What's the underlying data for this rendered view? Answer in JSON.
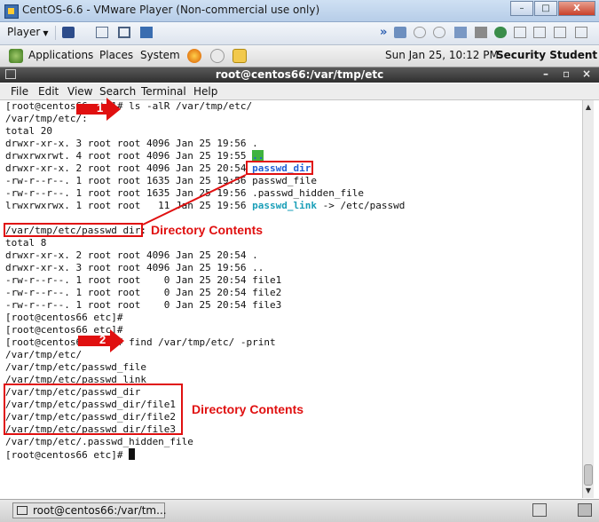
{
  "window": {
    "title": "CentOS-6.6 - VMware Player (Non-commercial use only)",
    "minimize": "–",
    "maximize": "□",
    "close": "X"
  },
  "vm_toolbar": {
    "player_label": "Player",
    "forward_glyph": "»"
  },
  "gnome_panel": {
    "applications": "Applications",
    "places": "Places",
    "system": "System",
    "datetime": "Sun Jan 25, 10:12 PM",
    "user": "Security Student"
  },
  "terminal": {
    "title": "root@centos66:/var/tmp/etc",
    "controls": [
      "–",
      "▫",
      "×"
    ],
    "menu": [
      "File",
      "Edit",
      "View",
      "Search",
      "Terminal",
      "Help"
    ],
    "lines": [
      "[root@centos66 etc]# ls -alR /var/tmp/etc/",
      "/var/tmp/etc/:",
      "total 20",
      "drwxr-xr-x. 3 root root 4096 Jan 25 19:56 .",
      "drwxrwxrwt. 4 root root 4096 Jan 25 19:55 ..",
      "drwxr-xr-x. 2 root root 4096 Jan 25 20:54 passwd_dir",
      "-rw-r--r--. 1 root root 1635 Jan 25 19:56 passwd_file",
      "-rw-r--r--. 1 root root 1635 Jan 25 19:56 .passwd_hidden_file",
      "lrwxrwxrwx. 1 root root   11 Jan 25 19:56 passwd_link -> /etc/passwd",
      "",
      "/var/tmp/etc/passwd_dir:",
      "total 8",
      "drwxr-xr-x. 2 root root 4096 Jan 25 20:54 .",
      "drwxr-xr-x. 3 root root 4096 Jan 25 19:56 ..",
      "-rw-r--r--. 1 root root    0 Jan 25 20:54 file1",
      "-rw-r--r--. 1 root root    0 Jan 25 20:54 file2",
      "-rw-r--r--. 1 root root    0 Jan 25 20:54 file3",
      "[root@centos66 etc]#",
      "[root@centos66 etc]#",
      "[root@centos66 etc]# find /var/tmp/etc/ -print",
      "/var/tmp/etc/",
      "/var/tmp/etc/passwd_file",
      "/var/tmp/etc/passwd_link",
      "/var/tmp/etc/passwd_dir",
      "/var/tmp/etc/passwd_dir/file1",
      "/var/tmp/etc/passwd_dir/file2",
      "/var/tmp/etc/passwd_dir/file3",
      "/var/tmp/etc/.passwd_hidden_file",
      "[root@centos66 etc]# "
    ]
  },
  "annotations": {
    "step1": "1",
    "step2": "2",
    "label_top": "Directory Contents",
    "label_bottom": "Directory Contents"
  },
  "taskbar": {
    "item": "root@centos66:/var/tm..."
  },
  "colors": {
    "annotation_red": "#e01010",
    "directory_blue": "#1f5fd6",
    "link_cyan": "#1a9fb8"
  }
}
